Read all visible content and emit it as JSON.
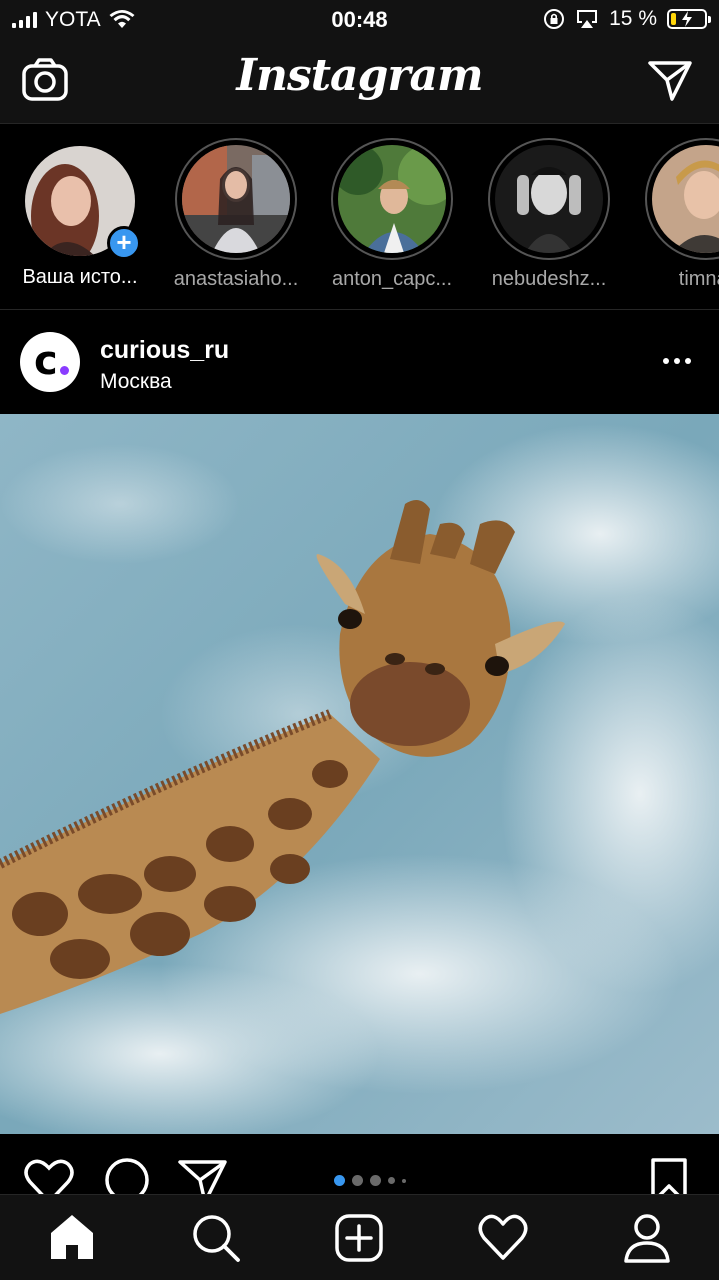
{
  "status_bar": {
    "carrier": "YOTA",
    "time": "00:48",
    "battery_percent": "15 %",
    "battery_level": 0.15,
    "battery_color": "#ffd60a"
  },
  "header": {
    "logo": "Instagram",
    "left_icon": "camera-icon",
    "right_icon": "direct-message-icon"
  },
  "stories": [
    {
      "name": "Ваша исто...",
      "own": true
    },
    {
      "name": "anastasiaho..."
    },
    {
      "name": "anton_capc..."
    },
    {
      "name": "nebudeshz..."
    },
    {
      "name": "timnat"
    }
  ],
  "post": {
    "username": "curious_ru",
    "location": "Москва",
    "avatar_letter": "c",
    "carousel_index": 1,
    "carousel_count": 5
  },
  "tabs": [
    {
      "icon": "home-icon",
      "active": true
    },
    {
      "icon": "search-icon"
    },
    {
      "icon": "new-post-icon"
    },
    {
      "icon": "activity-heart-icon"
    },
    {
      "icon": "profile-icon"
    }
  ],
  "colors": {
    "accent": "#3897f0",
    "background": "#000000",
    "bar": "#121212"
  }
}
